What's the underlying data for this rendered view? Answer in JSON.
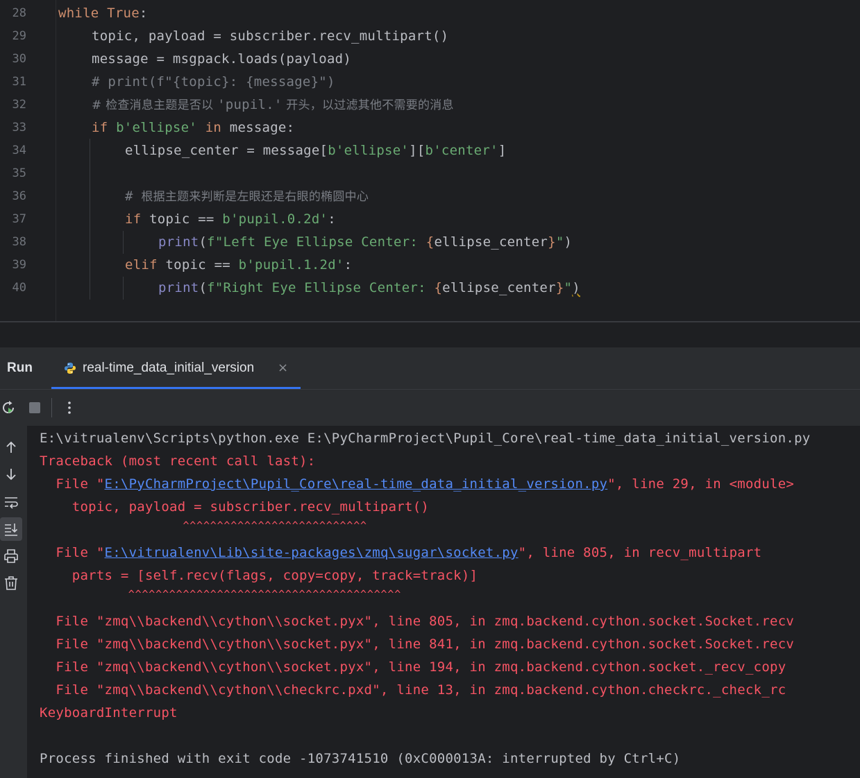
{
  "editor": {
    "line_numbers": [
      "28",
      "29",
      "30",
      "31",
      "32",
      "33",
      "34",
      "35",
      "36",
      "37",
      "38",
      "39",
      "40"
    ],
    "lines": {
      "l28_kw": "while",
      "l28_true": "True",
      "l28_colon": ":",
      "l29": "topic, payload = subscriber.recv_multipart()",
      "l30": "message = msgpack.loads(payload)",
      "l31": "# print(f\"{topic}: {message}\")",
      "l32_hash": "# 检查消息主题是否以 ",
      "l32_code": "'pupil.'",
      "l32_rest": " 开头，以过滤其他不需要的消息",
      "l33_if": "if",
      "l33_str": "b'ellipse'",
      "l33_in": "in",
      "l33_rest": " message:",
      "l34_a": "ellipse_center = message[",
      "l34_s1": "b'ellipse'",
      "l34_mid": "][",
      "l34_s2": "b'center'",
      "l34_end": "]",
      "l36_hash": "# ",
      "l36_text": "根据主题来判断是左眼还是右眼的椭圆中心",
      "l37_if": "if",
      "l37_mid": " topic == ",
      "l37_str": "b'pupil.0.2d'",
      "l37_end": ":",
      "l38_print": "print",
      "l38_open": "(",
      "l38_f": "f\"Left Eye Ellipse Center: ",
      "l38_lb": "{",
      "l38_var": "ellipse_center",
      "l38_rb": "}",
      "l38_q": "\"",
      "l38_close": ")",
      "l39_elif": "elif",
      "l39_mid": " topic == ",
      "l39_str": "b'pupil.1.2d'",
      "l39_end": ":",
      "l40_print": "print",
      "l40_open": "(",
      "l40_f": "f\"Right Eye Ellipse Center: ",
      "l40_lb": "{",
      "l40_var": "ellipse_center",
      "l40_rb": "}",
      "l40_q": "\"",
      "l40_close": ")"
    }
  },
  "run_panel": {
    "title": "Run",
    "tab_label": "real-time_data_initial_version",
    "tab_close": "×"
  },
  "console": {
    "cmd": "E:\\vitrualenv\\Scripts\\python.exe E:\\PyCharmProject\\Pupil_Core\\real-time_data_initial_version.py",
    "traceback": "Traceback (most recent call last):",
    "f1_pre": "  File \"",
    "f1_link": "E:\\PyCharmProject\\Pupil_Core\\real-time_data_initial_version.py",
    "f1_post": "\", line 29, in <module>",
    "f1_code": "    topic, payload = subscriber.recv_multipart()",
    "f1_caret": "                     ^^^^^^^^^^^^^^^^^^^^^^^^^^^",
    "f2_pre": "  File \"",
    "f2_link": "E:\\vitrualenv\\Lib\\site-packages\\zmq\\sugar\\socket.py",
    "f2_post": "\", line 805, in recv_multipart",
    "f2_code": "    parts = [self.recv(flags, copy=copy, track=track)]",
    "f2_caret": "             ^^^^^^^^^^^^^^^^^^^^^^^^^^^^^^^^^^^^^^^^",
    "f3": "  File \"zmq\\\\backend\\\\cython\\\\socket.pyx\", line 805, in zmq.backend.cython.socket.Socket.recv",
    "f4": "  File \"zmq\\\\backend\\\\cython\\\\socket.pyx\", line 841, in zmq.backend.cython.socket.Socket.recv",
    "f5": "  File \"zmq\\\\backend\\\\cython\\\\socket.pyx\", line 194, in zmq.backend.cython.socket._recv_copy",
    "f6": "  File \"zmq\\\\backend\\\\cython\\\\checkrc.pxd\", line 13, in zmq.backend.cython.checkrc._check_rc",
    "interrupt": "KeyboardInterrupt",
    "exit": "Process finished with exit code -1073741510 (0xC000013A: interrupted by Ctrl+C)"
  },
  "icons": {
    "rerun": "rerun-icon",
    "stop": "stop-icon",
    "more": "more-vertical-icon",
    "up": "arrow-up-icon",
    "down": "arrow-down-icon",
    "wrap": "soft-wrap-icon",
    "scroll_end": "scroll-to-end-icon",
    "print": "print-icon",
    "trash": "trash-icon",
    "python": "python-icon"
  },
  "colors": {
    "background": "#1e1f22",
    "panel": "#2b2d30",
    "keyword": "#cf8e6d",
    "string": "#6aab73",
    "comment": "#7a7e85",
    "error": "#f75464",
    "link": "#548af7",
    "accent": "#3574f0"
  }
}
